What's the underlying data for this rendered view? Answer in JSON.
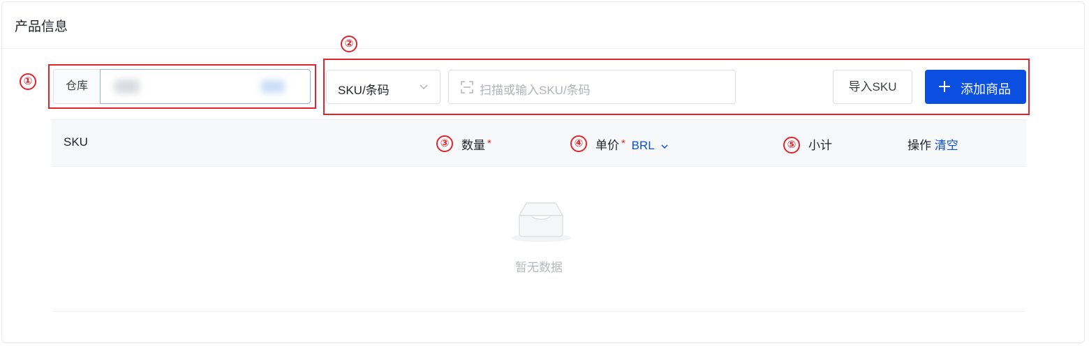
{
  "card": {
    "title": "产品信息"
  },
  "annotations": [
    "①",
    "②",
    "③",
    "④",
    "⑤"
  ],
  "warehouse": {
    "label": "仓库",
    "value": ""
  },
  "sku_type": {
    "selected": "SKU/条码"
  },
  "scan": {
    "placeholder": "扫描或输入SKU/条码"
  },
  "buttons": {
    "import": "导入SKU",
    "add": "添加商品"
  },
  "table": {
    "headers": {
      "sku": "SKU",
      "quantity": "数量",
      "unit_price": "单价",
      "currency": "BRL",
      "subtotal": "小计",
      "actions": "操作",
      "clear": "清空"
    },
    "required_mark": "*",
    "empty_text": "暂无数据"
  },
  "colors": {
    "primary": "#0a4fe0",
    "annotation": "#e0242b",
    "required": "#e0242b"
  },
  "icons": [
    "chevron-down-icon",
    "scan-icon",
    "plus-icon",
    "empty-inbox-icon"
  ]
}
